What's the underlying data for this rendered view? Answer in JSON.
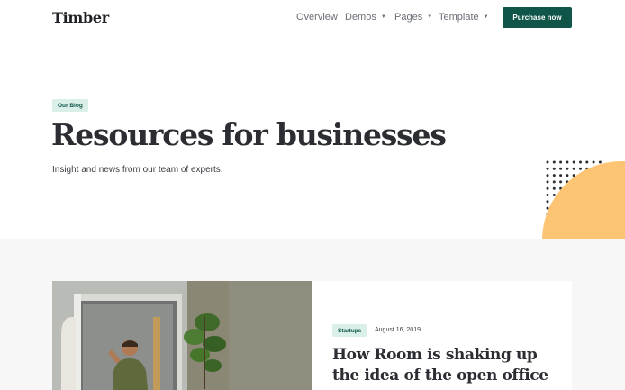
{
  "nav": {
    "logo": "Timber",
    "items": [
      {
        "label": "Overview",
        "dropdown": false
      },
      {
        "label": "Demos",
        "dropdown": true
      },
      {
        "label": "Pages",
        "dropdown": true
      },
      {
        "label": "Template",
        "dropdown": true
      }
    ],
    "cta": "Purchase now"
  },
  "hero": {
    "badge": "Our Blog",
    "title": "Resources for businesses",
    "subtitle": "Insight and news from our team of experts."
  },
  "featured_post": {
    "category": "Startups",
    "date": "August 16, 2019",
    "title": "How Room is shaking up the idea of the open office"
  },
  "colors": {
    "accent": "#0f5548",
    "badge_bg": "#d9efe8",
    "decor_orange": "#fdc473",
    "section_bg": "#f7f7f7"
  }
}
